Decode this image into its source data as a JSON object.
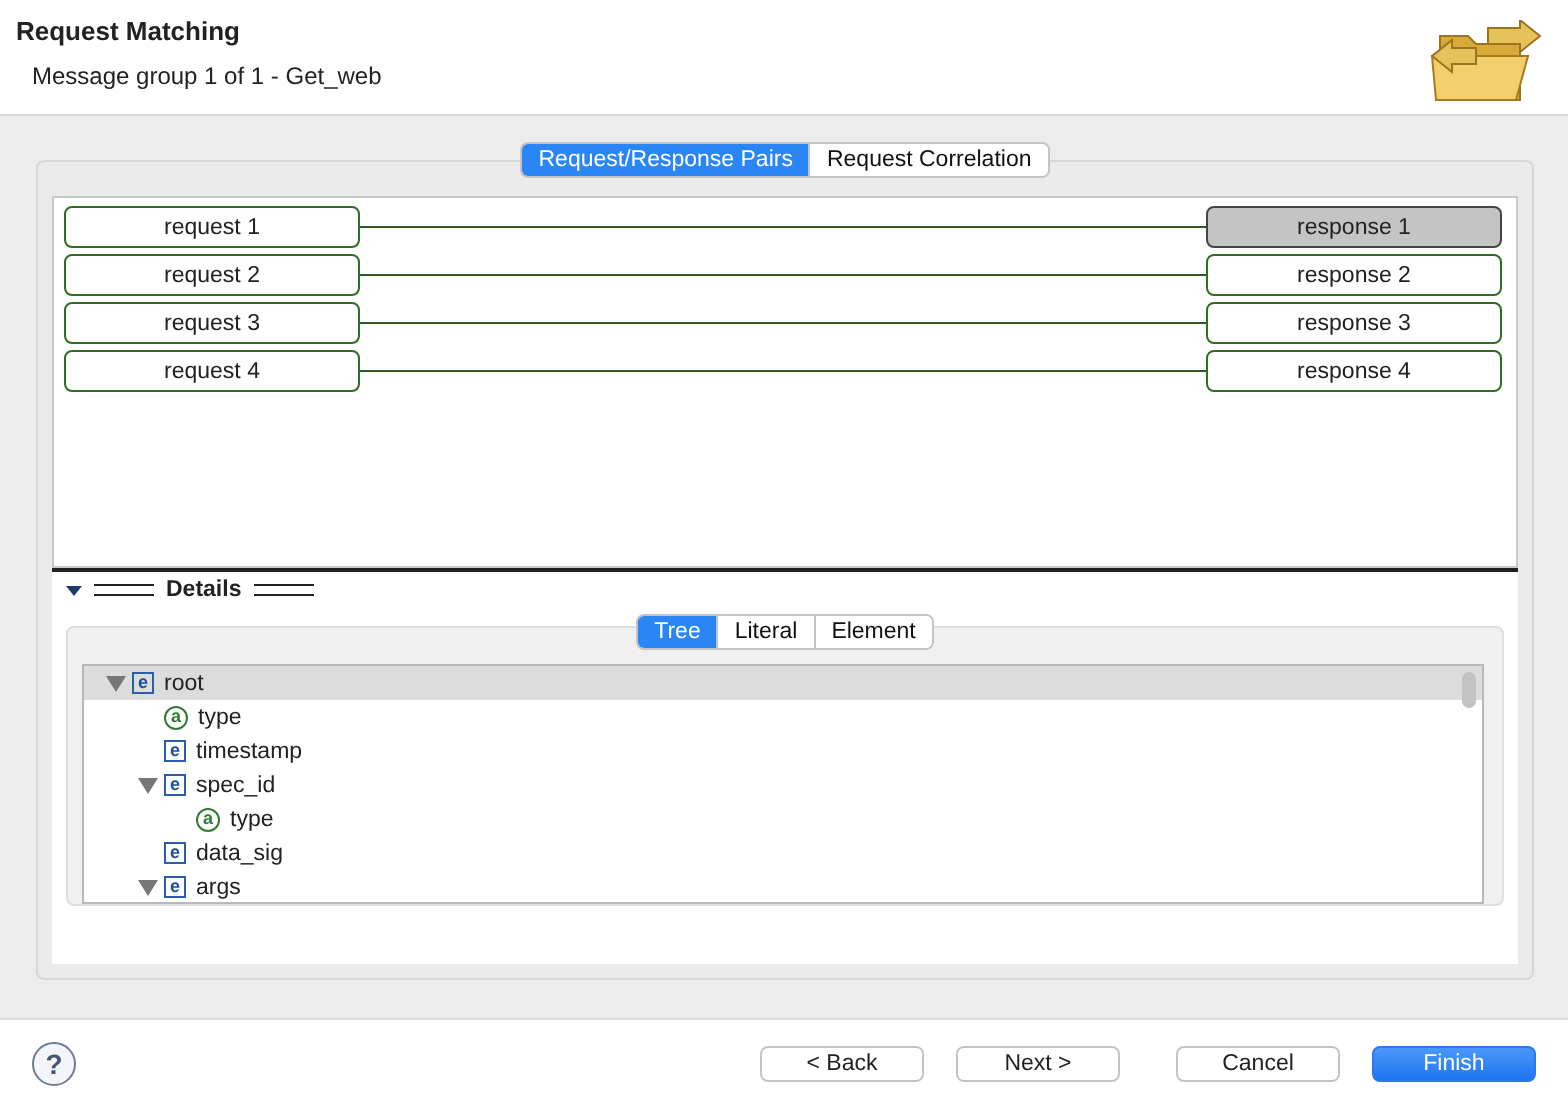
{
  "header": {
    "title": "Request Matching",
    "subtitle": "Message group 1 of 1 - Get_web"
  },
  "tabs": [
    {
      "label": "Request/Response Pairs",
      "selected": true
    },
    {
      "label": "Request Correlation",
      "selected": false
    }
  ],
  "pairs": [
    {
      "request": "request 1",
      "response": "response 1",
      "selected": true
    },
    {
      "request": "request 2",
      "response": "response 2",
      "selected": false
    },
    {
      "request": "request 3",
      "response": "response 3",
      "selected": false
    },
    {
      "request": "request 4",
      "response": "response 4",
      "selected": false
    }
  ],
  "details": {
    "label": "Details",
    "expanded": true,
    "tabs": [
      {
        "label": "Tree",
        "selected": true
      },
      {
        "label": "Literal",
        "selected": false
      },
      {
        "label": "Element",
        "selected": false
      }
    ],
    "tree": [
      {
        "kind": "element",
        "icon": "e",
        "label": "root",
        "expanded": true,
        "selected": true,
        "children": [
          {
            "kind": "attribute",
            "icon": "a",
            "label": "type",
            "selected": false
          },
          {
            "kind": "element",
            "icon": "e",
            "label": "timestamp",
            "selected": false
          },
          {
            "kind": "element",
            "icon": "e",
            "label": "spec_id",
            "expanded": true,
            "selected": false,
            "children": [
              {
                "kind": "attribute",
                "icon": "a",
                "label": "type",
                "selected": false
              }
            ]
          },
          {
            "kind": "element",
            "icon": "e",
            "label": "data_sig",
            "selected": false
          },
          {
            "kind": "element",
            "icon": "e",
            "label": "args",
            "expanded": true,
            "selected": false
          }
        ]
      }
    ]
  },
  "buttons": [
    {
      "label": "< Back",
      "kind": "normal"
    },
    {
      "label": "Next >",
      "kind": "normal"
    },
    {
      "label": "Cancel",
      "kind": "normal"
    },
    {
      "label": "Finish",
      "kind": "default"
    }
  ],
  "help": {
    "label": "?"
  }
}
